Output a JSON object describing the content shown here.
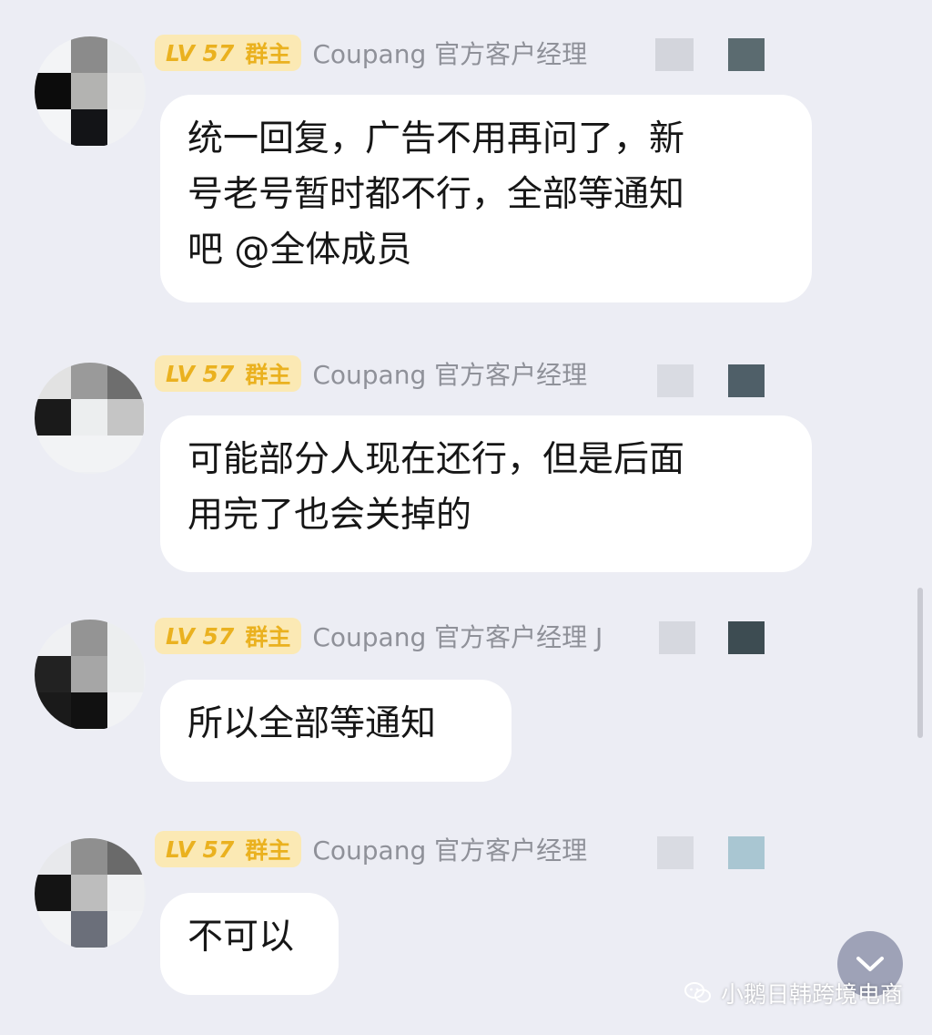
{
  "messages": [
    {
      "level": "LV 57",
      "role": "群主",
      "sender": "Coupang 官方客户经理",
      "text": "统一回复，广告不用再问了，新\n号老号暂时都不行，全部等通知\n吧 @全体成员"
    },
    {
      "level": "LV 57",
      "role": "群主",
      "sender": "Coupang 官方客户经理",
      "text": "可能部分人现在还行，但是后面\n用完了也会关掉的"
    },
    {
      "level": "LV 57",
      "role": "群主",
      "sender": "Coupang 官方客户经理 J",
      "text": "所以全部等通知"
    },
    {
      "level": "LV 57",
      "role": "群主",
      "sender": "Coupang 官方客户经理",
      "text": "不可以"
    }
  ],
  "watermark": {
    "text": "小鹅日韩跨境电商"
  },
  "icons": {
    "scroll_down": "chevron-down-icon",
    "watermark_logo": "wechat-logo-icon"
  },
  "colors": {
    "background": "#ecedf4",
    "bubble": "#ffffff",
    "badge_bg": "#fbe9b4",
    "badge_text": "#eab11f",
    "sender_text": "#8f9199",
    "message_text": "#161616"
  }
}
